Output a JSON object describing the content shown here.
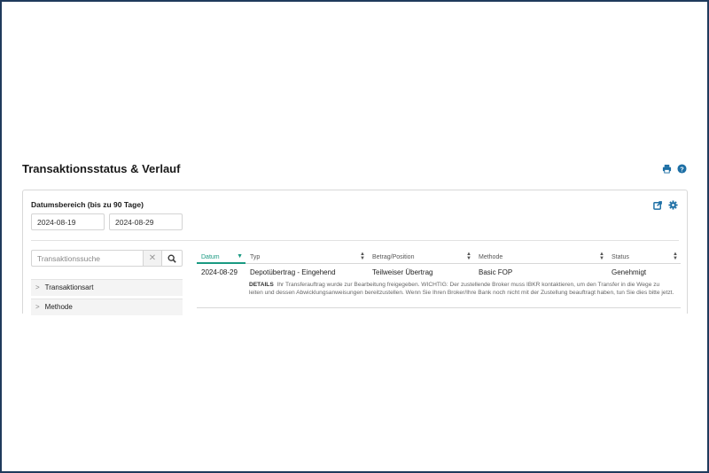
{
  "page": {
    "title": "Transaktionsstatus & Verlauf",
    "accent_color": "#1d6fa5",
    "active_color": "#1a9a82",
    "frame_color": "#1f3a5c"
  },
  "header_icons": [
    "print-icon",
    "help-icon"
  ],
  "date_range": {
    "label": "Datumsbereich (bis zu 90 Tage)",
    "from": "2024-08-19",
    "to": "2024-08-29"
  },
  "panel_icons": [
    "export-icon",
    "settings-icon"
  ],
  "search": {
    "placeholder": "Transaktionssuche"
  },
  "filters": [
    {
      "label": "Transaktionsart"
    },
    {
      "label": "Methode"
    }
  ],
  "table": {
    "columns": [
      "Datum",
      "Typ",
      "Betrag/Position",
      "Methode",
      "Status"
    ],
    "rows": [
      {
        "date": "2024-08-29",
        "type": "Depotübertrag - Eingehend",
        "amount": "Teilweiser Übertrag",
        "method": "Basic FOP",
        "status": "Genehmigt",
        "details_label": "DETAILS",
        "details_text": "Ihr Transferauftrag wurde zur Bearbeitung freigegeben. WICHTIG: Der zustellende Broker muss IBKR kontaktieren, um den Transfer in die Wege zu leiten und dessen Abwicklungsanweisungen bereitzustellen. Wenn Sie Ihren Broker/Ihre Bank noch nicht mit der Zustellung beauftragt haben, tun Sie dies bitte jetzt."
      }
    ]
  }
}
